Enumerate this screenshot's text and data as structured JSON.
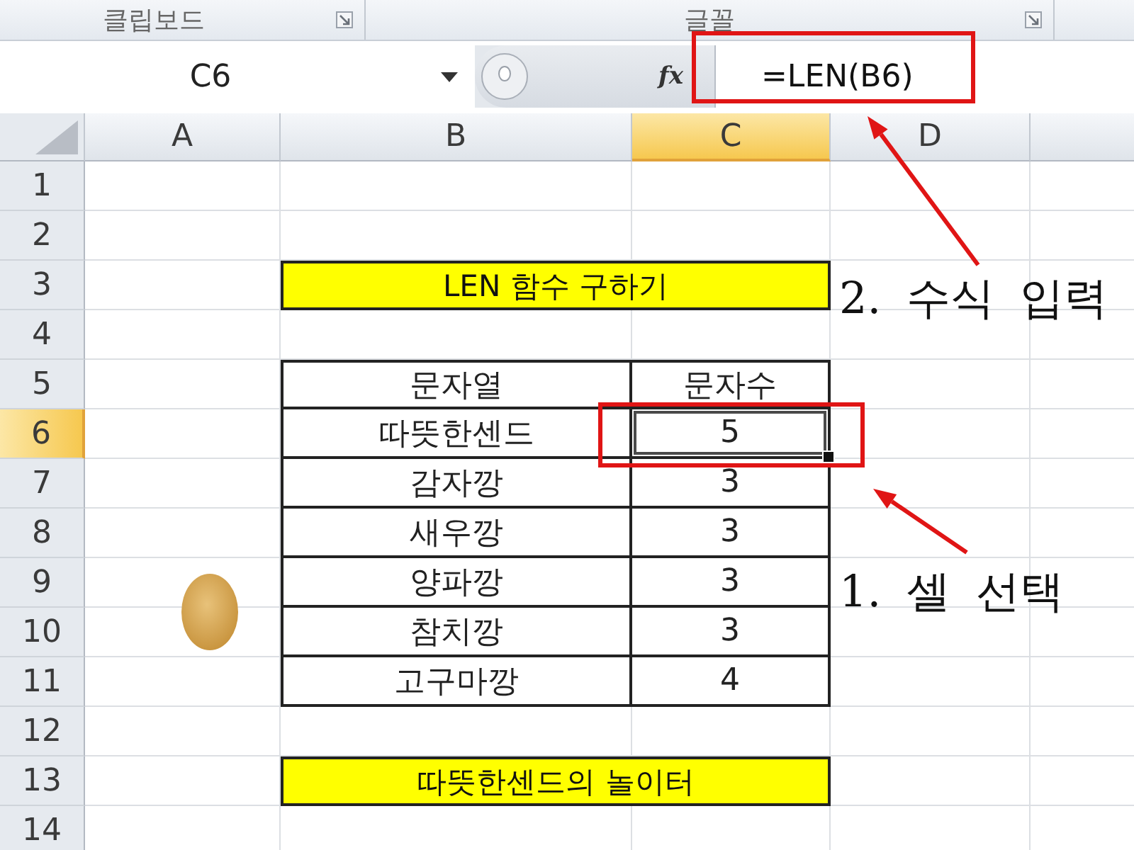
{
  "ribbon": {
    "groups": [
      {
        "label": "클립보드"
      },
      {
        "label": "글꼴"
      }
    ]
  },
  "formula_bar": {
    "name_box": "C6",
    "function_button": "fx",
    "formula": "=LEN(B6)"
  },
  "sheet": {
    "columns": [
      {
        "label": "A",
        "selected": false
      },
      {
        "label": "B",
        "selected": false
      },
      {
        "label": "C",
        "selected": true
      },
      {
        "label": "D",
        "selected": false
      }
    ],
    "rows": [
      {
        "label": "1",
        "selected": false
      },
      {
        "label": "2",
        "selected": false
      },
      {
        "label": "3",
        "selected": false,
        "banner": "LEN 함수 구하기"
      },
      {
        "label": "4",
        "selected": false
      },
      {
        "label": "5",
        "selected": false,
        "cells": [
          "문자열",
          "문자수"
        ]
      },
      {
        "label": "6",
        "selected": true,
        "cells": [
          "따뜻한센드",
          "5"
        ]
      },
      {
        "label": "7",
        "selected": false,
        "cells": [
          "감자깡",
          "3"
        ]
      },
      {
        "label": "8",
        "selected": false,
        "cells": [
          "새우깡",
          "3"
        ]
      },
      {
        "label": "9",
        "selected": false,
        "cells": [
          "양파깡",
          "3"
        ]
      },
      {
        "label": "10",
        "selected": false,
        "cells": [
          "참치깡",
          "3"
        ]
      },
      {
        "label": "11",
        "selected": false,
        "cells": [
          "고구마깡",
          "4"
        ]
      },
      {
        "label": "12",
        "selected": false
      },
      {
        "label": "13",
        "selected": false,
        "banner": "따뜻한센드의 놀이터"
      },
      {
        "label": "14",
        "selected": false
      }
    ]
  },
  "annotations": [
    {
      "text": "2. 수식 입력"
    },
    {
      "text": "1. 셀 선택"
    }
  ]
}
